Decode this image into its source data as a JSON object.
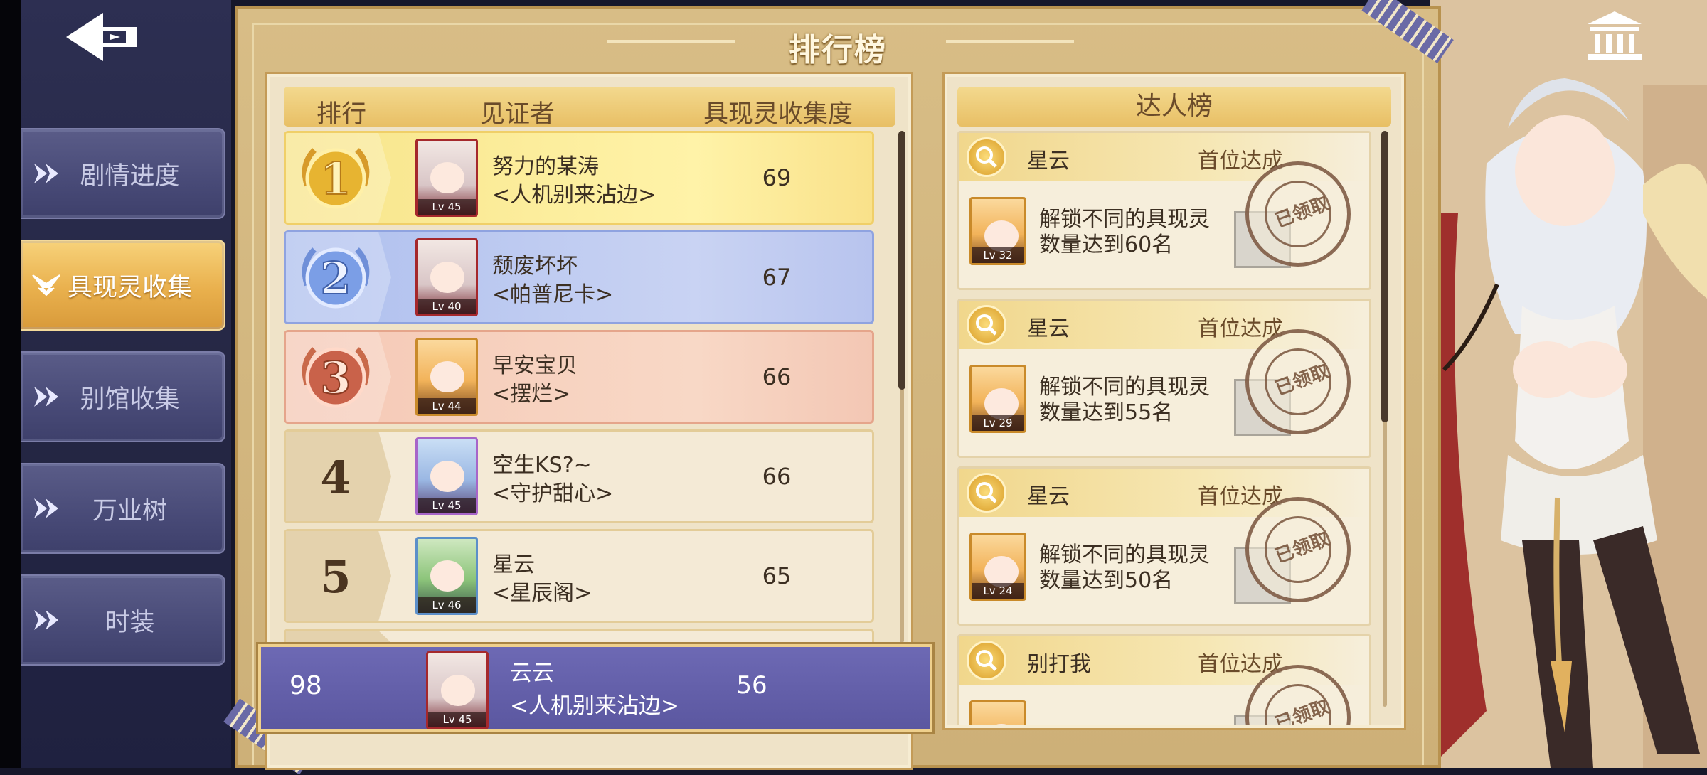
{
  "sidebar": {
    "items": [
      {
        "label": "剧情进度",
        "active": false
      },
      {
        "label": "具现灵收集",
        "active": true
      },
      {
        "label": "别馆收集",
        "active": false
      },
      {
        "label": "万业树",
        "active": false
      },
      {
        "label": "时装",
        "active": false
      }
    ]
  },
  "board": {
    "title": "排行榜"
  },
  "ranking": {
    "headers": {
      "rank": "排行",
      "witness": "见证者",
      "score": "具现灵收集度"
    },
    "rows": [
      {
        "rank": "1",
        "name": "努力的某涛",
        "guild": "<人机别来沾边>",
        "score": "69",
        "level": "Lv 45"
      },
      {
        "rank": "2",
        "name": "颓废坏坏",
        "guild": "<帕普尼卡>",
        "score": "67",
        "level": "Lv 40"
      },
      {
        "rank": "3",
        "name": "早安宝贝",
        "guild": "<摆烂>",
        "score": "66",
        "level": "Lv 44"
      },
      {
        "rank": "4",
        "name": "空生KS?~",
        "guild": "<守护甜心>",
        "score": "66",
        "level": "Lv 45"
      },
      {
        "rank": "5",
        "name": "星云",
        "guild": "<星辰阁>",
        "score": "65",
        "level": "Lv 46"
      }
    ],
    "self": {
      "rank": "98",
      "name": "云云",
      "guild": "<人机别来沾边>",
      "score": "56",
      "level": "Lv 45"
    }
  },
  "experts": {
    "title": "达人榜",
    "cards": [
      {
        "player": "星云",
        "tag": "首位达成",
        "desc1": "解锁不同的具现灵",
        "desc2": "数量达到60名",
        "level": "Lv 32",
        "stamp": "已领取"
      },
      {
        "player": "星云",
        "tag": "首位达成",
        "desc1": "解锁不同的具现灵",
        "desc2": "数量达到55名",
        "level": "Lv 29",
        "stamp": "已领取"
      },
      {
        "player": "星云",
        "tag": "首位达成",
        "desc1": "解锁不同的具现灵",
        "desc2": "数量达到50名",
        "level": "Lv 24",
        "stamp": "已领取"
      },
      {
        "player": "别打我",
        "tag": "首位达成",
        "stamp": "已领取"
      }
    ]
  },
  "icons": {
    "back": "back-arrow-icon",
    "museum": "museum-building-icon",
    "search": "magnifier-icon",
    "chevron": "double-chevron-icon"
  },
  "colors": {
    "gold": "#e9b04d",
    "navy": "#2d2f52",
    "self_row": "#5b57a0",
    "parchment": "#efe3c8"
  }
}
